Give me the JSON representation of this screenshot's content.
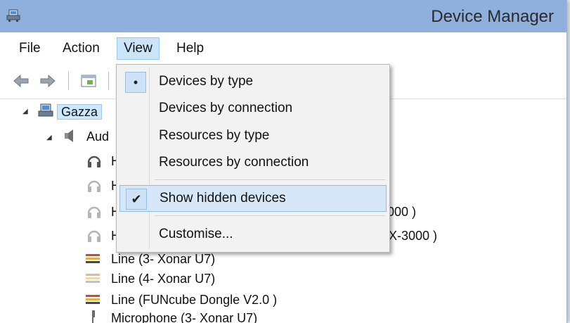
{
  "window": {
    "title": "Device Manager"
  },
  "menu": {
    "file": "File",
    "action": "Action",
    "view": "View",
    "help": "Help"
  },
  "view_menu": {
    "items": [
      {
        "label": "Devices by type",
        "mark": "•"
      },
      {
        "label": "Devices by connection",
        "mark": ""
      },
      {
        "label": "Resources by type",
        "mark": ""
      },
      {
        "label": "Resources by connection",
        "mark": ""
      },
      {
        "label": "Show hidden devices",
        "mark": "✔"
      },
      {
        "label": "Customise...",
        "mark": ""
      }
    ]
  },
  "tree": {
    "root": "Gazza",
    "category": "Aud",
    "items": [
      {
        "text": "H",
        "icon": "headphones-icon"
      },
      {
        "text": "H",
        "icon": "headphones-disabled-icon"
      },
      {
        "text": "H",
        "icon": "headphones-disabled-icon",
        "tail": "000 )"
      },
      {
        "text": "H",
        "icon": "headphones-disabled-icon",
        "tail": "X-3000 )"
      },
      {
        "text": "Line (3- Xonar U7)",
        "icon": "line-in-icon"
      },
      {
        "text": "Line (4- Xonar U7)",
        "icon": "line-in-disabled-icon"
      },
      {
        "text": "Line (FUNcube Dongle V2.0  )",
        "icon": "line-in-icon"
      },
      {
        "text": "Microphone (3- Xonar U7)",
        "icon": "microphone-icon"
      }
    ]
  }
}
